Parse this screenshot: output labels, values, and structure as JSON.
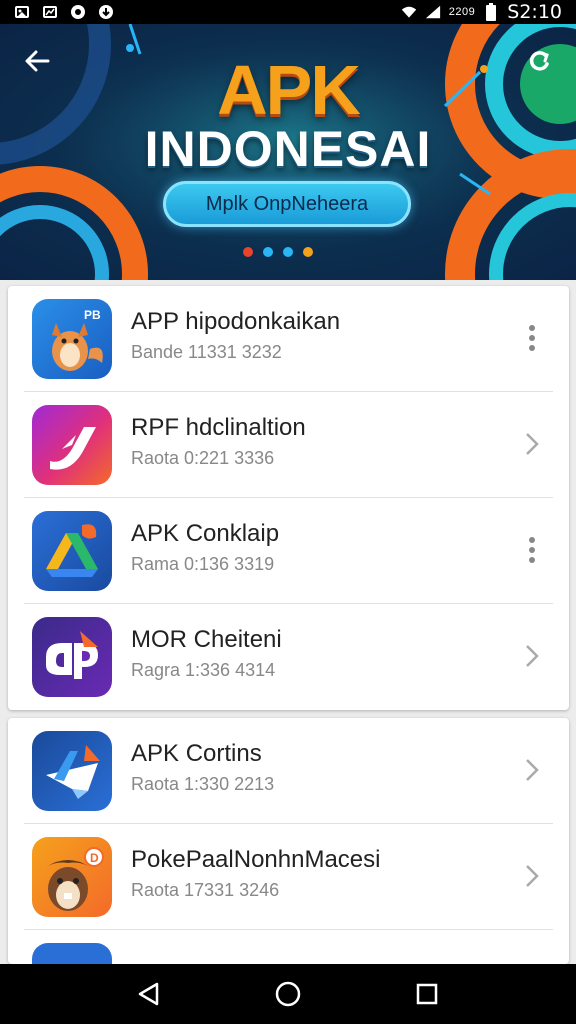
{
  "status_bar": {
    "left_icons": [
      "image-icon",
      "photo-icon",
      "record-icon",
      "download-icon"
    ],
    "network_label": "2209",
    "time": "S2:10"
  },
  "banner": {
    "title": "APK",
    "subtitle": "INDONESAI",
    "pill_label": "Mplk OnpNeheera",
    "dot_colors": [
      "#e8442a",
      "#29b6f6",
      "#29b6f6",
      "#f5a11c"
    ]
  },
  "apps_primary": [
    {
      "name": "APP hipodonkaikan",
      "meta": "Bande 11331 3232",
      "icon": "fox-app-icon",
      "action": "more-vert-icon"
    },
    {
      "name": "RPF hdclinaltion",
      "meta": "Raota 0:221 3336",
      "icon": "swirl-app-icon",
      "action": "chevron-right-icon"
    },
    {
      "name": "APK Conklaip",
      "meta": "Rama 0:136 3319",
      "icon": "drive-app-icon",
      "action": "more-vert-icon"
    },
    {
      "name": "MOR Cheiteni",
      "meta": "Ragra 1:336 4314",
      "icon": "ap-app-icon",
      "action": "chevron-right-icon"
    }
  ],
  "apps_secondary": [
    {
      "name": "APK Cortins",
      "meta": "Raota 1:330 2213",
      "icon": "plane-app-icon",
      "action": "chevron-right-icon"
    },
    {
      "name": "PokePaalNonhnMacesi",
      "meta": "Raota 17331 3246",
      "icon": "beaver-app-icon",
      "action": "chevron-right-icon"
    }
  ],
  "colors": {
    "banner_orange": "#f5a11c",
    "banner_blue": "#1a9bd8",
    "text_primary": "#222222",
    "text_secondary": "#888888"
  }
}
